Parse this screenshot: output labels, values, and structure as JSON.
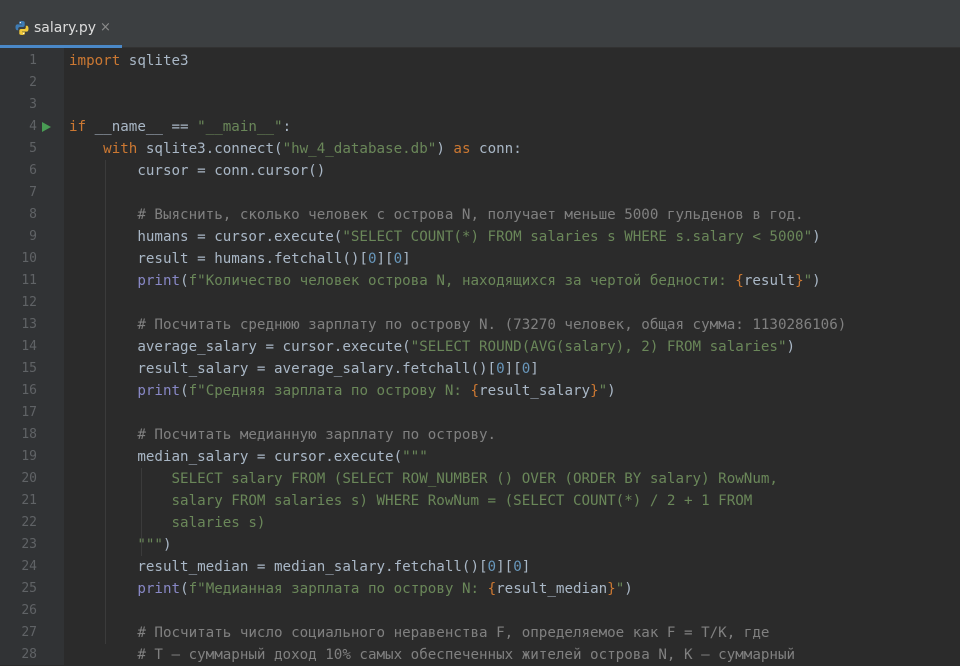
{
  "tab": {
    "filename": "salary.py",
    "close": "×",
    "icon": "python-file-icon"
  },
  "lines": [
    {
      "n": "1",
      "tokens": [
        [
          "kw",
          "import"
        ],
        [
          "pl",
          " sqlite3"
        ]
      ]
    },
    {
      "n": "2",
      "tokens": []
    },
    {
      "n": "3",
      "tokens": []
    },
    {
      "n": "4",
      "run": true,
      "tokens": [
        [
          "kw",
          "if"
        ],
        [
          "pl",
          " __name__ == "
        ],
        [
          "st",
          "\"__main__\""
        ],
        [
          "pl",
          ":"
        ]
      ]
    },
    {
      "n": "5",
      "tokens": [
        [
          "pl",
          "    "
        ],
        [
          "kw",
          "with"
        ],
        [
          "pl",
          " sqlite3.connect("
        ],
        [
          "st",
          "\"hw_4_database.db\""
        ],
        [
          "pl",
          ") "
        ],
        [
          "kw",
          "as"
        ],
        [
          "pl",
          " conn:"
        ]
      ]
    },
    {
      "n": "6",
      "tokens": [
        [
          "pl",
          "        cursor = conn.cursor()"
        ]
      ]
    },
    {
      "n": "7",
      "tokens": []
    },
    {
      "n": "8",
      "tokens": [
        [
          "pl",
          "        "
        ],
        [
          "cm",
          "# Выяснить, сколько человек с острова N, получает меньше 5000 гульденов в год."
        ]
      ]
    },
    {
      "n": "9",
      "tokens": [
        [
          "pl",
          "        humans = cursor.execute("
        ],
        [
          "st",
          "\"SELECT COUNT(*) FROM salaries s WHERE s.salary < 5000\""
        ],
        [
          "pl",
          ")"
        ]
      ]
    },
    {
      "n": "10",
      "tokens": [
        [
          "pl",
          "        result = humans.fetchall()["
        ],
        [
          "nm",
          "0"
        ],
        [
          "pl",
          "]["
        ],
        [
          "nm",
          "0"
        ],
        [
          "pl",
          "]"
        ]
      ]
    },
    {
      "n": "11",
      "tokens": [
        [
          "pl",
          "        "
        ],
        [
          "bi",
          "print"
        ],
        [
          "pl",
          "("
        ],
        [
          "st",
          "f\"Количество человек острова N, находящихся за чертой бедности: "
        ],
        [
          "br",
          "{"
        ],
        [
          "pl",
          "result"
        ],
        [
          "br",
          "}"
        ],
        [
          "st",
          "\""
        ],
        [
          "pl",
          ")"
        ]
      ]
    },
    {
      "n": "12",
      "tokens": []
    },
    {
      "n": "13",
      "tokens": [
        [
          "pl",
          "        "
        ],
        [
          "cm",
          "# Посчитать среднюю зарплату по острову N. (73270 человек, общая сумма: 1130286106)"
        ]
      ]
    },
    {
      "n": "14",
      "tokens": [
        [
          "pl",
          "        average_salary = cursor.execute("
        ],
        [
          "st",
          "\"SELECT ROUND(AVG(salary), 2) FROM salaries\""
        ],
        [
          "pl",
          ")"
        ]
      ]
    },
    {
      "n": "15",
      "tokens": [
        [
          "pl",
          "        result_salary = average_salary.fetchall()["
        ],
        [
          "nm",
          "0"
        ],
        [
          "pl",
          "]["
        ],
        [
          "nm",
          "0"
        ],
        [
          "pl",
          "]"
        ]
      ]
    },
    {
      "n": "16",
      "tokens": [
        [
          "pl",
          "        "
        ],
        [
          "bi",
          "print"
        ],
        [
          "pl",
          "("
        ],
        [
          "st",
          "f\"Средняя зарплата по острову N: "
        ],
        [
          "br",
          "{"
        ],
        [
          "pl",
          "result_salary"
        ],
        [
          "br",
          "}"
        ],
        [
          "st",
          "\""
        ],
        [
          "pl",
          ")"
        ]
      ]
    },
    {
      "n": "17",
      "tokens": []
    },
    {
      "n": "18",
      "tokens": [
        [
          "pl",
          "        "
        ],
        [
          "cm",
          "# Посчитать медианную зарплату по острову."
        ]
      ]
    },
    {
      "n": "19",
      "tokens": [
        [
          "pl",
          "        median_salary = cursor.execute("
        ],
        [
          "st",
          "\"\"\""
        ]
      ]
    },
    {
      "n": "20",
      "tokens": [
        [
          "st",
          "            SELECT salary FROM (SELECT ROW_NUMBER () OVER (ORDER BY salary) RowNum,"
        ]
      ]
    },
    {
      "n": "21",
      "tokens": [
        [
          "st",
          "            salary FROM salaries s) WHERE RowNum = (SELECT COUNT(*) / 2 + 1 FROM"
        ]
      ]
    },
    {
      "n": "22",
      "tokens": [
        [
          "st",
          "            salaries s)"
        ]
      ]
    },
    {
      "n": "23",
      "tokens": [
        [
          "st",
          "        \"\"\""
        ],
        [
          "pl",
          ")"
        ]
      ]
    },
    {
      "n": "24",
      "tokens": [
        [
          "pl",
          "        result_median = median_salary.fetchall()["
        ],
        [
          "nm",
          "0"
        ],
        [
          "pl",
          "]["
        ],
        [
          "nm",
          "0"
        ],
        [
          "pl",
          "]"
        ]
      ]
    },
    {
      "n": "25",
      "tokens": [
        [
          "pl",
          "        "
        ],
        [
          "bi",
          "print"
        ],
        [
          "pl",
          "("
        ],
        [
          "st",
          "f\"Медианная зарплата по острову N: "
        ],
        [
          "br",
          "{"
        ],
        [
          "pl",
          "result_median"
        ],
        [
          "br",
          "}"
        ],
        [
          "st",
          "\""
        ],
        [
          "pl",
          ")"
        ]
      ]
    },
    {
      "n": "26",
      "tokens": []
    },
    {
      "n": "27",
      "tokens": [
        [
          "pl",
          "        "
        ],
        [
          "cm",
          "# Посчитать число социального неравенства F, определяемое как F = T/K, где"
        ]
      ]
    },
    {
      "n": "28",
      "tokens": [
        [
          "pl",
          "        "
        ],
        [
          "cm",
          "# T — суммарный доход 10% самых обеспеченных жителей острова N, K — суммарный"
        ]
      ]
    }
  ]
}
